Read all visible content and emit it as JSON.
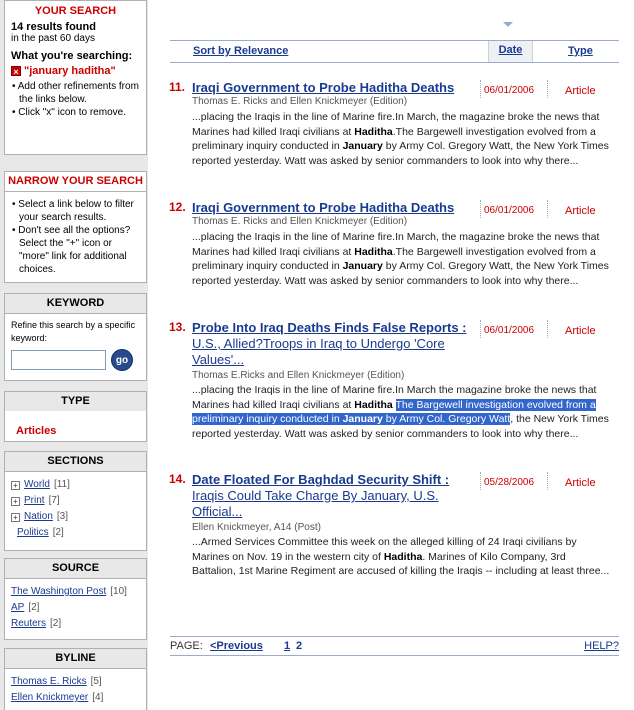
{
  "sidebar": {
    "your_search": {
      "title": "YOUR SEARCH",
      "results_count": "14 results found",
      "timeframe": "in the past 60 days",
      "searching_label": "What you're searching:",
      "term": "\"january haditha\"",
      "tips": [
        "Add other refinements from the links below.",
        "Click \"x\" icon to remove."
      ]
    },
    "narrow": {
      "title": "NARROW YOUR SEARCH",
      "tips": [
        "Select a link below to filter your search results.",
        "Don't see all the options? Select the \"+\" icon or \"more\" link for additional choices."
      ]
    },
    "keyword": {
      "title": "KEYWORD",
      "desc": "Refine this search by a specific keyword:",
      "input_value": "",
      "go_label": "go"
    },
    "type": {
      "title": "TYPE",
      "value": "Articles"
    },
    "sections": {
      "title": "SECTIONS",
      "items": [
        {
          "label": "World",
          "count": "[11]"
        },
        {
          "label": "Print",
          "count": "[7]"
        },
        {
          "label": "Nation",
          "count": "[3]"
        },
        {
          "label": "Politics",
          "count": "[2]"
        }
      ]
    },
    "source": {
      "title": "SOURCE",
      "items": [
        {
          "label": "The Washington Post",
          "count": "[10]"
        },
        {
          "label": "AP",
          "count": "[2]"
        },
        {
          "label": "Reuters",
          "count": "[2]"
        }
      ]
    },
    "byline": {
      "title": "BYLINE",
      "items": [
        {
          "label": "Thomas E. Ricks",
          "count": "[5]"
        },
        {
          "label": "Ellen Knickmeyer",
          "count": "[4]"
        }
      ]
    }
  },
  "sort": {
    "relevance": "Sort by Relevance",
    "date": "Date",
    "type": "Type"
  },
  "results": [
    {
      "num": "11.",
      "title": "Iraqi Government to Probe Haditha Deaths",
      "subtitle": "",
      "date": "06/01/2006",
      "type": "Article",
      "byline": "Thomas E. Ricks and Ellen Knickmeyer (Edition)",
      "snippet": "...placing the Iraqis in the line of Marine fire.In March, the magazine broke the news that Marines had killed Iraqi civilians at Haditha.The Bargewell investigation evolved from a preliminary inquiry conducted in January by Army Col. Gregory Watt, the New York Times reported yesterday. Watt was asked by senior commanders to look into why there..."
    },
    {
      "num": "12.",
      "title": "Iraqi Government to Probe Haditha Deaths",
      "subtitle": "",
      "date": "06/01/2006",
      "type": "Article",
      "byline": "Thomas E. Ricks and Ellen Knickmeyer (Edition)",
      "snippet": "...placing the Iraqis in the line of Marine fire.In March, the magazine broke the news that Marines had killed Iraqi civilians at Haditha.The Bargewell investigation evolved from a preliminary inquiry conducted in January by Army Col. Gregory Watt, the New York Times reported yesterday. Watt was asked by senior commanders to look into why there..."
    },
    {
      "num": "13.",
      "title": "Probe Into Iraq Deaths Finds False Reports :",
      "subtitle": "U.S., Allied?Troops in Iraq to Undergo 'Core Values'...",
      "date": "06/01/2006",
      "type": "Article",
      "byline": "Thomas E.Ricks and Ellen Knickmeyer (Edition)",
      "snippet": "...placing the Iraqis in the line of Marine fire.In March the magazine broke the news that Marines had killed Iraqi civilians at Haditha The Bargewell investigation evolved from a preliminary inquiry conducted in January by Army Col. Gregory Watt, the New York Times reported yesterday. Watt was asked by senior commanders to look into why there..."
    },
    {
      "num": "14.",
      "title": "Date Floated For Baghdad Security Shift :",
      "subtitle": "Iraqis Could Take Charge By January, U.S. Official...",
      "date": "05/28/2006",
      "type": "Article",
      "byline": "Ellen Knickmeyer, A14 (Post)",
      "snippet": "...Armed Services Committee this week on the alleged killing of 24 Iraqi civilians by Marines on Nov. 19 in the western city of Haditha. Marines of Kilo Company, 3rd Battalion, 1st Marine Regiment are accused of killing the Iraqis -- including at least three..."
    }
  ],
  "pager": {
    "label": "PAGE:",
    "prev": "<Previous",
    "p1": "1",
    "p2": "2",
    "help": "HELP?"
  }
}
